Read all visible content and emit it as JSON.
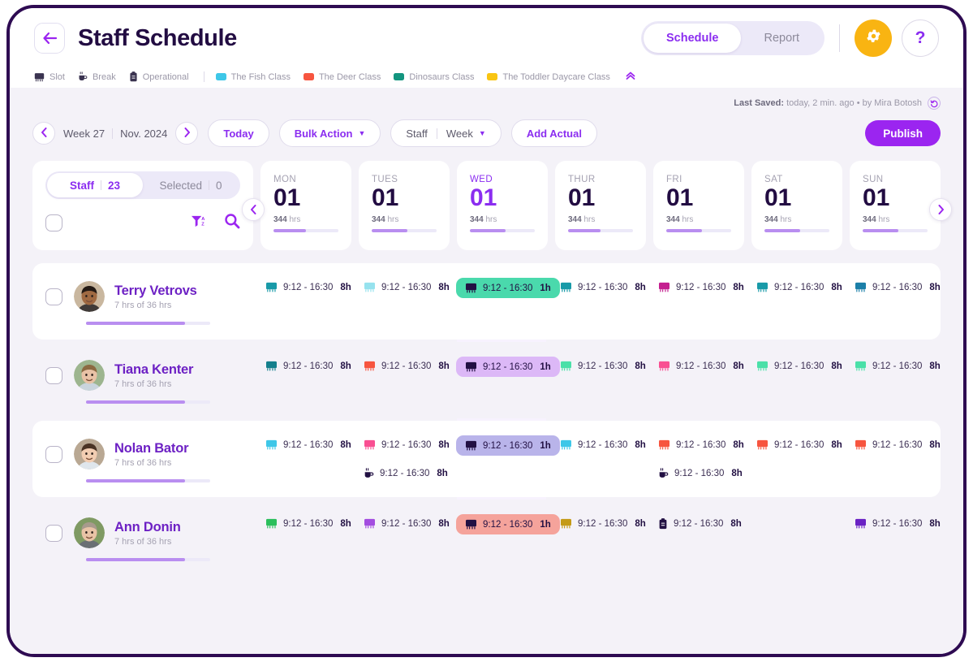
{
  "header": {
    "back_icon": "arrow-left-icon",
    "title": "Staff Schedule",
    "tabs": [
      {
        "label": "Schedule",
        "active": true
      },
      {
        "label": "Report",
        "active": false
      }
    ],
    "gear_icon": "gear-icon",
    "help_label": "?"
  },
  "legend": {
    "types": [
      {
        "label": "Slot",
        "icon": "slot-icon"
      },
      {
        "label": "Break",
        "icon": "break-icon"
      },
      {
        "label": "Operational",
        "icon": "operational-icon"
      }
    ],
    "classes": [
      {
        "label": "The Fish Class",
        "color": "#3ec7e8"
      },
      {
        "label": "The Deer Class",
        "color": "#f7553f"
      },
      {
        "label": "Dinosaurs Class",
        "color": "#13957f"
      },
      {
        "label": "The Toddler Daycare Class",
        "color": "#f9c513"
      }
    ],
    "collapse_icon": "chevrons-up-icon"
  },
  "saved": {
    "label": "Last Saved:",
    "value": "today, 2 min. ago • by Mira Botosh",
    "revert_icon": "revert-icon"
  },
  "toolbar": {
    "prev_icon": "chevron-left-icon",
    "next_icon": "chevron-right-icon",
    "week": "Week 27",
    "month": "Nov. 2024",
    "today_label": "Today",
    "bulk_action_label": "Bulk Action",
    "scope_label": "Staff",
    "range_label": "Week",
    "add_actual_label": "Add Actual",
    "publish_label": "Publish"
  },
  "staff_panel": {
    "tabs": [
      {
        "label": "Staff",
        "count": "23",
        "active": true
      },
      {
        "label": "Selected",
        "count": "0",
        "active": false
      }
    ],
    "select_all_checkbox": false,
    "sort_icon": "filter-sort-az-icon",
    "search_icon": "search-icon"
  },
  "days": [
    {
      "name": "MON",
      "num": "01",
      "hours": "344",
      "hours_unit": "hrs",
      "progress": 50,
      "today": false
    },
    {
      "name": "TUES",
      "num": "01",
      "hours": "344",
      "hours_unit": "hrs",
      "progress": 55,
      "today": false
    },
    {
      "name": "WED",
      "num": "01",
      "hours": "344",
      "hours_unit": "hrs",
      "progress": 55,
      "today": true
    },
    {
      "name": "THUR",
      "num": "01",
      "hours": "344",
      "hours_unit": "hrs",
      "progress": 50,
      "today": false
    },
    {
      "name": "FRI",
      "num": "01",
      "hours": "344",
      "hours_unit": "hrs",
      "progress": 55,
      "today": false
    },
    {
      "name": "SAT",
      "num": "01",
      "hours": "344",
      "hours_unit": "hrs",
      "progress": 55,
      "today": false
    },
    {
      "name": "SUN",
      "num": "01",
      "hours": "344",
      "hours_unit": "hrs",
      "progress": 55,
      "today": false
    }
  ],
  "grid_nav": {
    "left_icon": "chevron-left-icon",
    "right_icon": "chevron-right-icon"
  },
  "rows": [
    {
      "name": "Terry Vetrovs",
      "hours_text": "7 hrs of 36 hrs",
      "progress": 80,
      "avatar": "avatar-terry",
      "checked": false,
      "cells": [
        [
          {
            "icon": "slot-icon",
            "color": "#189aa8",
            "time": "9:12 - 16:30",
            "hrs": "8h",
            "selected": false
          }
        ],
        [
          {
            "icon": "slot-icon",
            "color": "#96e2ee",
            "time": "9:12 - 16:30",
            "hrs": "8h",
            "selected": false
          }
        ],
        [
          {
            "icon": "slot-icon",
            "color": "#221043",
            "time": "9:12 - 16:30",
            "hrs": "1h",
            "selected": true,
            "bg": "#4ad9ac"
          }
        ],
        [
          {
            "icon": "slot-icon",
            "color": "#189aa8",
            "time": "9:12 - 16:30",
            "hrs": "8h",
            "selected": false
          }
        ],
        [
          {
            "icon": "slot-icon",
            "color": "#c41f8f",
            "time": "9:12 - 16:30",
            "hrs": "8h",
            "selected": false
          }
        ],
        [
          {
            "icon": "slot-icon",
            "color": "#189aa8",
            "time": "9:12 - 16:30",
            "hrs": "8h",
            "selected": false
          }
        ],
        [
          {
            "icon": "slot-icon",
            "color": "#1b7fa8",
            "time": "9:12 - 16:30",
            "hrs": "8h",
            "selected": false
          }
        ]
      ]
    },
    {
      "name": "Tiana Kenter",
      "hours_text": "7 hrs of 36 hrs",
      "progress": 80,
      "avatar": "avatar-tiana",
      "checked": false,
      "cells": [
        [
          {
            "icon": "slot-icon",
            "color": "#147f8c",
            "time": "9:12 - 16:30",
            "hrs": "8h",
            "selected": false
          }
        ],
        [
          {
            "icon": "slot-icon",
            "color": "#f7553f",
            "time": "9:12 - 16:30",
            "hrs": "8h",
            "selected": false
          }
        ],
        [
          {
            "icon": "slot-icon",
            "color": "#221043",
            "time": "9:12 - 16:30",
            "hrs": "1h",
            "selected": true,
            "bg": "#dcb8f7"
          }
        ],
        [
          {
            "icon": "slot-icon",
            "color": "#4ae0a8",
            "time": "9:12 - 16:30",
            "hrs": "8h",
            "selected": false
          }
        ],
        [
          {
            "icon": "slot-icon",
            "color": "#f94f92",
            "time": "9:12 - 16:30",
            "hrs": "8h",
            "selected": false
          }
        ],
        [
          {
            "icon": "slot-icon",
            "color": "#4ae0a8",
            "time": "9:12 - 16:30",
            "hrs": "8h",
            "selected": false
          }
        ],
        [
          {
            "icon": "slot-icon",
            "color": "#4ae0a8",
            "time": "9:12 - 16:30",
            "hrs": "8h",
            "selected": false
          }
        ]
      ]
    },
    {
      "name": "Nolan Bator",
      "hours_text": "7 hrs of 36 hrs",
      "progress": 80,
      "avatar": "avatar-nolan",
      "checked": false,
      "cells": [
        [
          {
            "icon": "slot-icon",
            "color": "#3ec7e8",
            "time": "9:12 - 16:30",
            "hrs": "8h",
            "selected": false
          }
        ],
        [
          {
            "icon": "slot-icon",
            "color": "#f94f92",
            "time": "9:12 - 16:30",
            "hrs": "8h",
            "selected": false
          },
          {
            "icon": "break-icon",
            "color": "#221043",
            "time": "9:12 - 16:30",
            "hrs": "8h",
            "selected": false
          }
        ],
        [
          {
            "icon": "slot-icon",
            "color": "#221043",
            "time": "9:12 - 16:30",
            "hrs": "1h",
            "selected": true,
            "bg": "#b9b4ea"
          }
        ],
        [
          {
            "icon": "slot-icon",
            "color": "#3ec7e8",
            "time": "9:12 - 16:30",
            "hrs": "8h",
            "selected": false
          }
        ],
        [
          {
            "icon": "slot-icon",
            "color": "#f7553f",
            "time": "9:12 - 16:30",
            "hrs": "8h",
            "selected": false
          },
          {
            "icon": "break-icon",
            "color": "#221043",
            "time": "9:12 - 16:30",
            "hrs": "8h",
            "selected": false
          }
        ],
        [
          {
            "icon": "slot-icon",
            "color": "#f7553f",
            "time": "9:12 - 16:30",
            "hrs": "8h",
            "selected": false
          }
        ],
        [
          {
            "icon": "slot-icon",
            "color": "#f7553f",
            "time": "9:12 - 16:30",
            "hrs": "8h",
            "selected": false
          }
        ]
      ]
    },
    {
      "name": "Ann Donin",
      "hours_text": "7 hrs of 36 hrs",
      "progress": 80,
      "avatar": "avatar-ann",
      "checked": false,
      "cells": [
        [
          {
            "icon": "slot-icon",
            "color": "#2bbf5c",
            "time": "9:12 - 16:30",
            "hrs": "8h",
            "selected": false
          }
        ],
        [
          {
            "icon": "slot-icon",
            "color": "#a34de0",
            "time": "9:12 - 16:30",
            "hrs": "8h",
            "selected": false
          }
        ],
        [
          {
            "icon": "slot-icon",
            "color": "#221043",
            "time": "9:12 - 16:30",
            "hrs": "1h",
            "selected": true,
            "bg": "#f5a39b"
          }
        ],
        [
          {
            "icon": "slot-icon",
            "color": "#c49a16",
            "time": "9:12 - 16:30",
            "hrs": "8h",
            "selected": false
          }
        ],
        [
          {
            "icon": "operational-icon",
            "color": "#221043",
            "time": "9:12 - 16:30",
            "hrs": "8h",
            "selected": false
          }
        ],
        [],
        [
          {
            "icon": "slot-icon",
            "color": "#6a22c4",
            "time": "9:12 - 16:30",
            "hrs": "8h",
            "selected": false
          }
        ]
      ]
    }
  ],
  "colors": {
    "accent": "#8b2df0",
    "publish": "#9b25f0",
    "gear": "#f9b412",
    "dark": "#220c42",
    "page_bg": "#f4f2f8",
    "frame_border": "#2e0b52"
  }
}
